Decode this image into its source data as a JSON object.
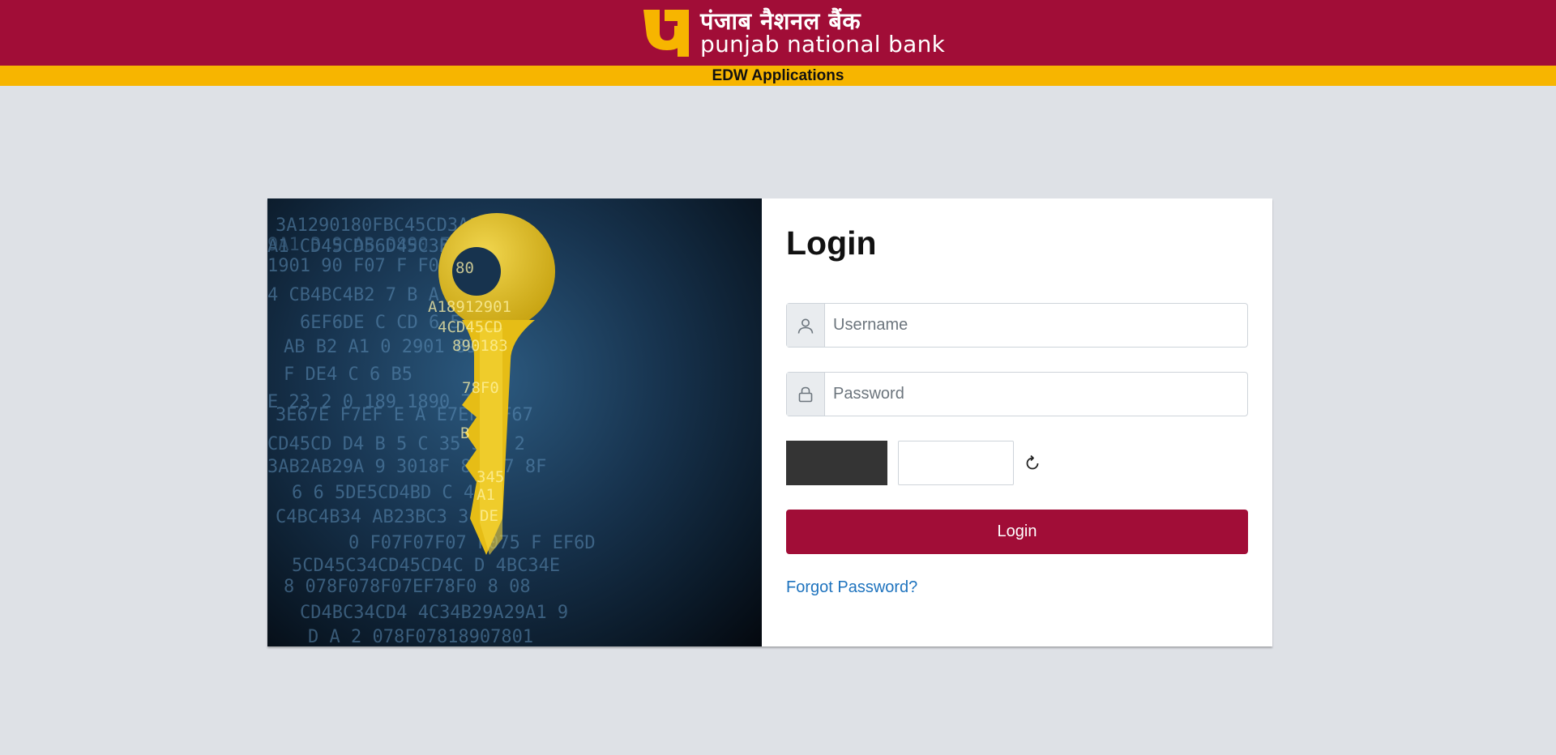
{
  "header": {
    "brand_hindi": "पंजाब नैशनल बैंक",
    "brand_english": "punjab national bank",
    "subtitle": "EDW Applications"
  },
  "login": {
    "title": "Login",
    "username_placeholder": "Username",
    "password_placeholder": "Password",
    "submit_label": "Login",
    "forgot_label": "Forgot Password?"
  },
  "icons": {
    "username": "user-icon",
    "password": "lock-icon",
    "captcha_refresh": "refresh-icon",
    "hero": "golden-key-on-digital-code-image"
  },
  "colors": {
    "brand_maroon": "#a10d37",
    "brand_yellow": "#f7b500",
    "page_background": "#dee1e6",
    "link_blue": "#1e73be"
  }
}
